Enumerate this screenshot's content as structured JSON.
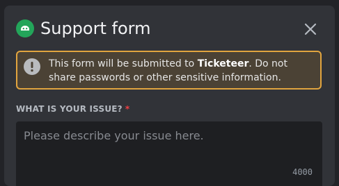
{
  "modal": {
    "title": "Support form",
    "app_icon": "discord-bot-icon",
    "close_icon": "close-icon"
  },
  "notice": {
    "icon": "exclamation-circle-icon",
    "text_before": "This form will be submitted to ",
    "app_name": "Ticketeer",
    "text_after": ". Do not share passwords or other sensitive information.",
    "border_color": "#e2a53f"
  },
  "field": {
    "label": "WHAT IS YOUR ISSUE?",
    "required_marker": "*",
    "value": "",
    "placeholder": "Please describe your issue here.",
    "char_limit": "4000"
  },
  "colors": {
    "accent_green": "#23a55a",
    "required_red": "#f23f43",
    "modal_bg": "#313338"
  }
}
